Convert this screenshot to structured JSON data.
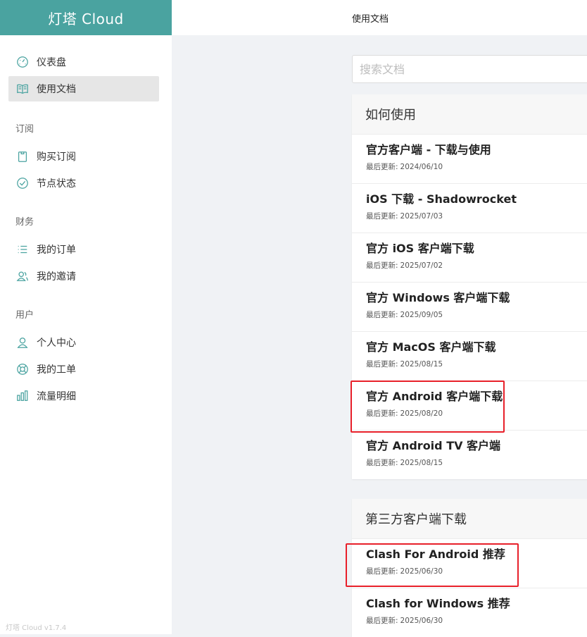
{
  "app": {
    "brand": "灯塔 Cloud",
    "version": "灯塔 Cloud v1.7.4",
    "accent_color": "#4aa3a0"
  },
  "header": {
    "title": "使用文档"
  },
  "sidebar": {
    "top_items": [
      {
        "label": "仪表盘",
        "icon": "dashboard-icon"
      },
      {
        "label": "使用文档",
        "icon": "book-icon",
        "active": true
      }
    ],
    "groups": [
      {
        "title": "订阅",
        "items": [
          {
            "label": "购买订阅",
            "icon": "clipboard-icon"
          },
          {
            "label": "节点状态",
            "icon": "check-circle-icon"
          }
        ]
      },
      {
        "title": "财务",
        "items": [
          {
            "label": "我的订单",
            "icon": "list-icon"
          },
          {
            "label": "我的邀请",
            "icon": "users-icon"
          }
        ]
      },
      {
        "title": "用户",
        "items": [
          {
            "label": "个人中心",
            "icon": "user-icon"
          },
          {
            "label": "我的工单",
            "icon": "lifebuoy-icon"
          },
          {
            "label": "流量明细",
            "icon": "bar-chart-icon"
          }
        ]
      }
    ]
  },
  "search": {
    "placeholder": "搜索文档",
    "value": ""
  },
  "update_label": "最后更新:",
  "sections": [
    {
      "title": "如何使用",
      "docs": [
        {
          "title": "官方客户端 - 下载与使用",
          "date": "2024/06/10"
        },
        {
          "title": "iOS 下载 - Shadowrocket",
          "date": "2025/07/03"
        },
        {
          "title": "官方 iOS 客户端下载",
          "date": "2025/07/02"
        },
        {
          "title": "官方 Windows 客户端下载",
          "date": "2025/09/05"
        },
        {
          "title": "官方 MacOS 客户端下载",
          "date": "2025/08/15"
        },
        {
          "title": "官方 Android 客户端下载",
          "date": "2025/08/20",
          "highlighted": true
        },
        {
          "title": "官方 Android TV 客户端",
          "date": "2025/08/15"
        }
      ]
    },
    {
      "title": "第三方客户端下载",
      "docs": [
        {
          "title": "Clash For Android 推荐",
          "date": "2025/06/30",
          "highlighted": true
        },
        {
          "title": "Clash for Windows 推荐",
          "date": "2025/06/30"
        }
      ]
    }
  ],
  "highlight_color": "#e8202a"
}
